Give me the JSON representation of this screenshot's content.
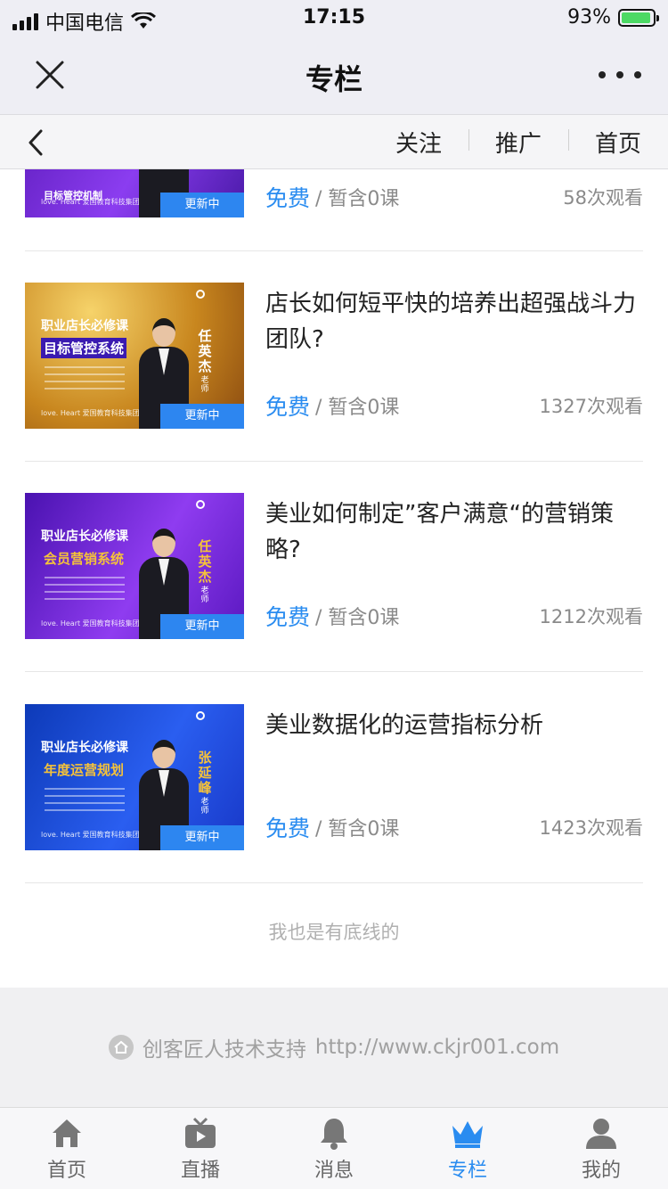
{
  "status_bar": {
    "carrier": "中国电信",
    "time": "17:15",
    "battery_percent": "93%",
    "battery_level": 0.93
  },
  "title_bar": {
    "title": "专栏"
  },
  "sub_nav": {
    "links": [
      "关注",
      "推广",
      "首页"
    ]
  },
  "thumb_common": {
    "badge": "更新中",
    "teacher_label": "老师",
    "subtitle": "职业店长必修课",
    "footer": "love. Heart 爱国教育科技集团"
  },
  "items": [
    {
      "thumb_topic": "目标管控机制",
      "price": "免费",
      "lessons": "/ 暂含0课",
      "views": "58次观看",
      "theme": "purple"
    },
    {
      "title": "店长如何短平快的培养出超强战斗力团队?",
      "thumb_topic": "目标管控系统",
      "thumb_name": "任英杰",
      "price": "免费",
      "lessons": "/ 暂含0课",
      "views": "1327次观看",
      "theme": "gold"
    },
    {
      "title": "美业如何制定”客户满意“的营销策略?",
      "thumb_topic": "会员营销系统",
      "thumb_name": "任英杰",
      "price": "免费",
      "lessons": "/ 暂含0课",
      "views": "1212次观看",
      "theme": "purple"
    },
    {
      "title": "美业数据化的运营指标分析",
      "thumb_topic": "年度运营规划",
      "thumb_name": "张延峰",
      "price": "免费",
      "lessons": "/ 暂含0课",
      "views": "1423次观看",
      "theme": "blue"
    }
  ],
  "bottom_line": "我也是有底线的",
  "support": {
    "text": "创客匠人技术支持",
    "url": "http://www.ckjr001.com"
  },
  "tabs": [
    {
      "label": "首页",
      "icon": "home-icon",
      "active": false
    },
    {
      "label": "直播",
      "icon": "tv-icon",
      "active": false
    },
    {
      "label": "消息",
      "icon": "bell-icon",
      "active": false
    },
    {
      "label": "专栏",
      "icon": "crown-icon",
      "active": true
    },
    {
      "label": "我的",
      "icon": "user-icon",
      "active": false
    }
  ],
  "colors": {
    "accent": "#2a8cf0",
    "badge": "#2d86f0",
    "muted": "#8a8a8a"
  }
}
